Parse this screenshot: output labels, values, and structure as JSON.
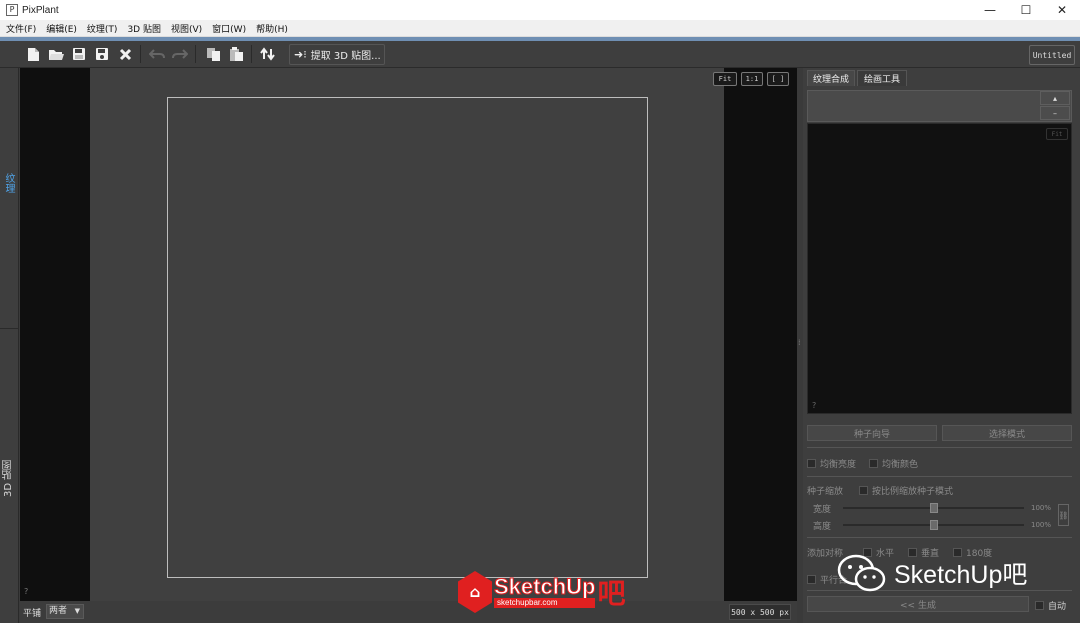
{
  "window": {
    "title": "PixPlant",
    "minimize": "—",
    "maximize": "☐",
    "close": "✕"
  },
  "menu": [
    "文件(F)",
    "编辑(E)",
    "纹理(T)",
    "3D 贴图",
    "视图(V)",
    "窗口(W)",
    "帮助(H)"
  ],
  "toolbar": {
    "extract_label": "提取 3D 贴图...",
    "document_name": "Untitled",
    "icons": [
      "new-icon",
      "open-icon",
      "save-icon",
      "save-as-icon",
      "close-icon",
      "undo-icon",
      "redo-icon",
      "copy-icon",
      "paste-icon",
      "swap-icon"
    ]
  },
  "left_tabs": {
    "texture": "纹理",
    "map3d": "3D 贴图"
  },
  "viewport": {
    "zoom_fit": "Fit",
    "zoom_1to1": "1:1",
    "zoom_fullscreen": "[ ]",
    "help": "?",
    "tile_label": "平铺",
    "tile_value": "两者",
    "size": "500 x 500 px"
  },
  "right_panel": {
    "tabs": [
      "纹理合成",
      "绘画工具"
    ],
    "spin_up": "▴",
    "spin_down": "–",
    "preview_fit": "Fit",
    "preview_help": "?",
    "seed_wizard": "种子向导",
    "select_pattern": "选择模式",
    "equalize_brightness": "均衡亮度",
    "equalize_color": "均衡颜色",
    "seed_scale": "种子缩放",
    "scale_by_pattern": "按比例缩放种子模式",
    "width_label": "宽度",
    "width_pct": "100%",
    "width_value": 0.5,
    "height_label": "高度",
    "height_pct": "100%",
    "height_value": 0.5,
    "add_mirror": "添加对称",
    "horizontal": "水平",
    "vertical": "垂直",
    "rot180": "180度",
    "parallel": "平行合",
    "generate": "<< 生成",
    "auto": "自动"
  },
  "watermarks": {
    "logo1_big": "SketchUp",
    "logo1_small": "sketchupbar.com",
    "logo1_ba": "吧",
    "logo2": "SketchUp吧"
  }
}
